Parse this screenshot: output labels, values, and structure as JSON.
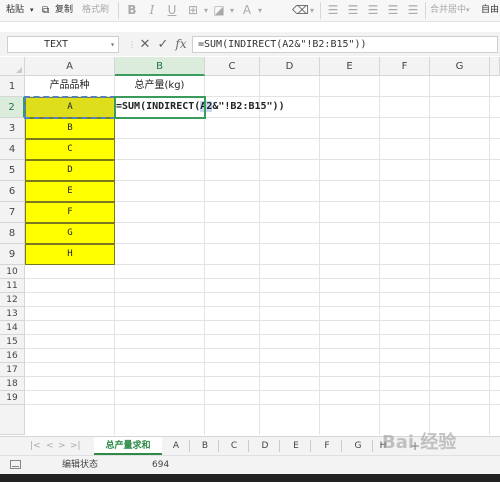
{
  "ribbon": {
    "paste_label": "粘贴",
    "copy_label": "复制",
    "format_painter_label": "格式刷",
    "bold": "B",
    "italic": "I",
    "underline": "U",
    "merge_center_label": "合并居中",
    "auto_label": "自由"
  },
  "formula_bar": {
    "name_box": "TEXT",
    "cancel_symbol": "✕",
    "enter_symbol": "✓",
    "fx_label": "fx",
    "formula": "=SUM(INDIRECT(A2&\"!B2:B15\"))"
  },
  "columns": [
    "A",
    "B",
    "C",
    "D",
    "E",
    "F",
    "G"
  ],
  "rows": [
    "1",
    "2",
    "3",
    "4",
    "5",
    "6",
    "7",
    "8",
    "9",
    "10",
    "11",
    "12",
    "13",
    "14",
    "15",
    "16",
    "17",
    "18",
    "19"
  ],
  "cells": {
    "a1": "产品品种",
    "b1": "总产量(kg)",
    "col_a_items": [
      "A",
      "B",
      "C",
      "D",
      "E",
      "F",
      "G",
      "H"
    ],
    "b2_edit": {
      "func_text": "=SUM(INDIRECT(",
      "ref_text": "A2",
      "rest_text": "&\"!B2:B15\"))"
    }
  },
  "sheet_tabs": [
    "总产量求和",
    "A",
    "B",
    "C",
    "D",
    "E",
    "F",
    "G",
    "H"
  ],
  "active_tab": "总产量求和",
  "status_bar": {
    "mode": "编辑状态",
    "value": "694"
  },
  "watermark": "Bai 经验",
  "colors": {
    "highlight_yellow": "#ffff00",
    "selection_green": "#3b9b5a",
    "reference_blue": "#c6d9f0"
  }
}
